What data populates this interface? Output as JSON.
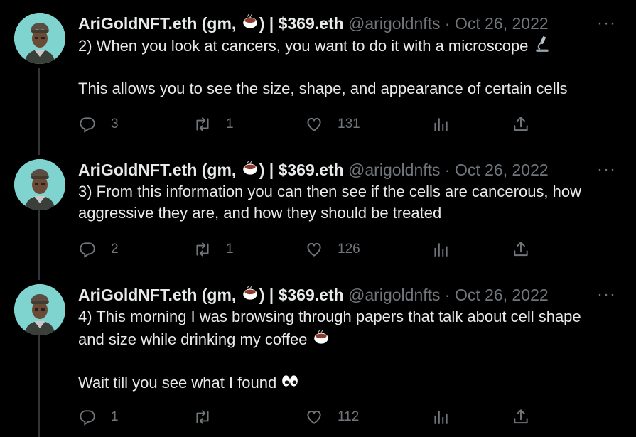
{
  "tweets": [
    {
      "author_name": "AriGoldNFT.eth (gm, ",
      "author_name_suffix": ") | $369.eth",
      "handle": "@arigoldnfts",
      "separator": "·",
      "date": "Oct 26, 2022",
      "more": "···",
      "text_lines": [
        "2) When you look at cancers, you want to do it with a microscope"
      ],
      "text_trailing_icon": "microscope-emoji",
      "text_paragraph2": "This allows you to see the size, shape, and appearance of certain cells",
      "replies": "3",
      "retweets": "1",
      "likes": "131"
    },
    {
      "author_name": "AriGoldNFT.eth (gm, ",
      "author_name_suffix": ") | $369.eth",
      "handle": "@arigoldnfts",
      "separator": "·",
      "date": "Oct 26, 2022",
      "more": "···",
      "text": "3) From this information you can then see if the cells are cancerous, how\naggressive they are, and how they should be treated",
      "replies": "2",
      "retweets": "1",
      "likes": "126"
    },
    {
      "author_name": "AriGoldNFT.eth (gm, ",
      "author_name_suffix": ") | $369.eth",
      "handle": "@arigoldnfts",
      "separator": "·",
      "date": "Oct 26, 2022",
      "more": "···",
      "text_line1": "4) This morning I was browsing through papers that talk about cell shape",
      "text_line2": "and size while drinking my coffee",
      "text_line2_icon": "coffee-emoji",
      "text_paragraph2": "Wait till you see what I found",
      "text_paragraph2_icon": "eyes-emoji",
      "replies": "1",
      "retweets": "",
      "likes": "112"
    }
  ],
  "colors": {
    "background": "#000000",
    "text": "#e7e9ea",
    "muted": "#71767b",
    "avatar_bg": "#7fd4cf",
    "thread_line": "#333639"
  },
  "icons": [
    "reply-icon",
    "retweet-icon",
    "like-icon",
    "analytics-icon",
    "share-icon",
    "coffee-emoji",
    "microscope-emoji",
    "eyes-emoji"
  ]
}
